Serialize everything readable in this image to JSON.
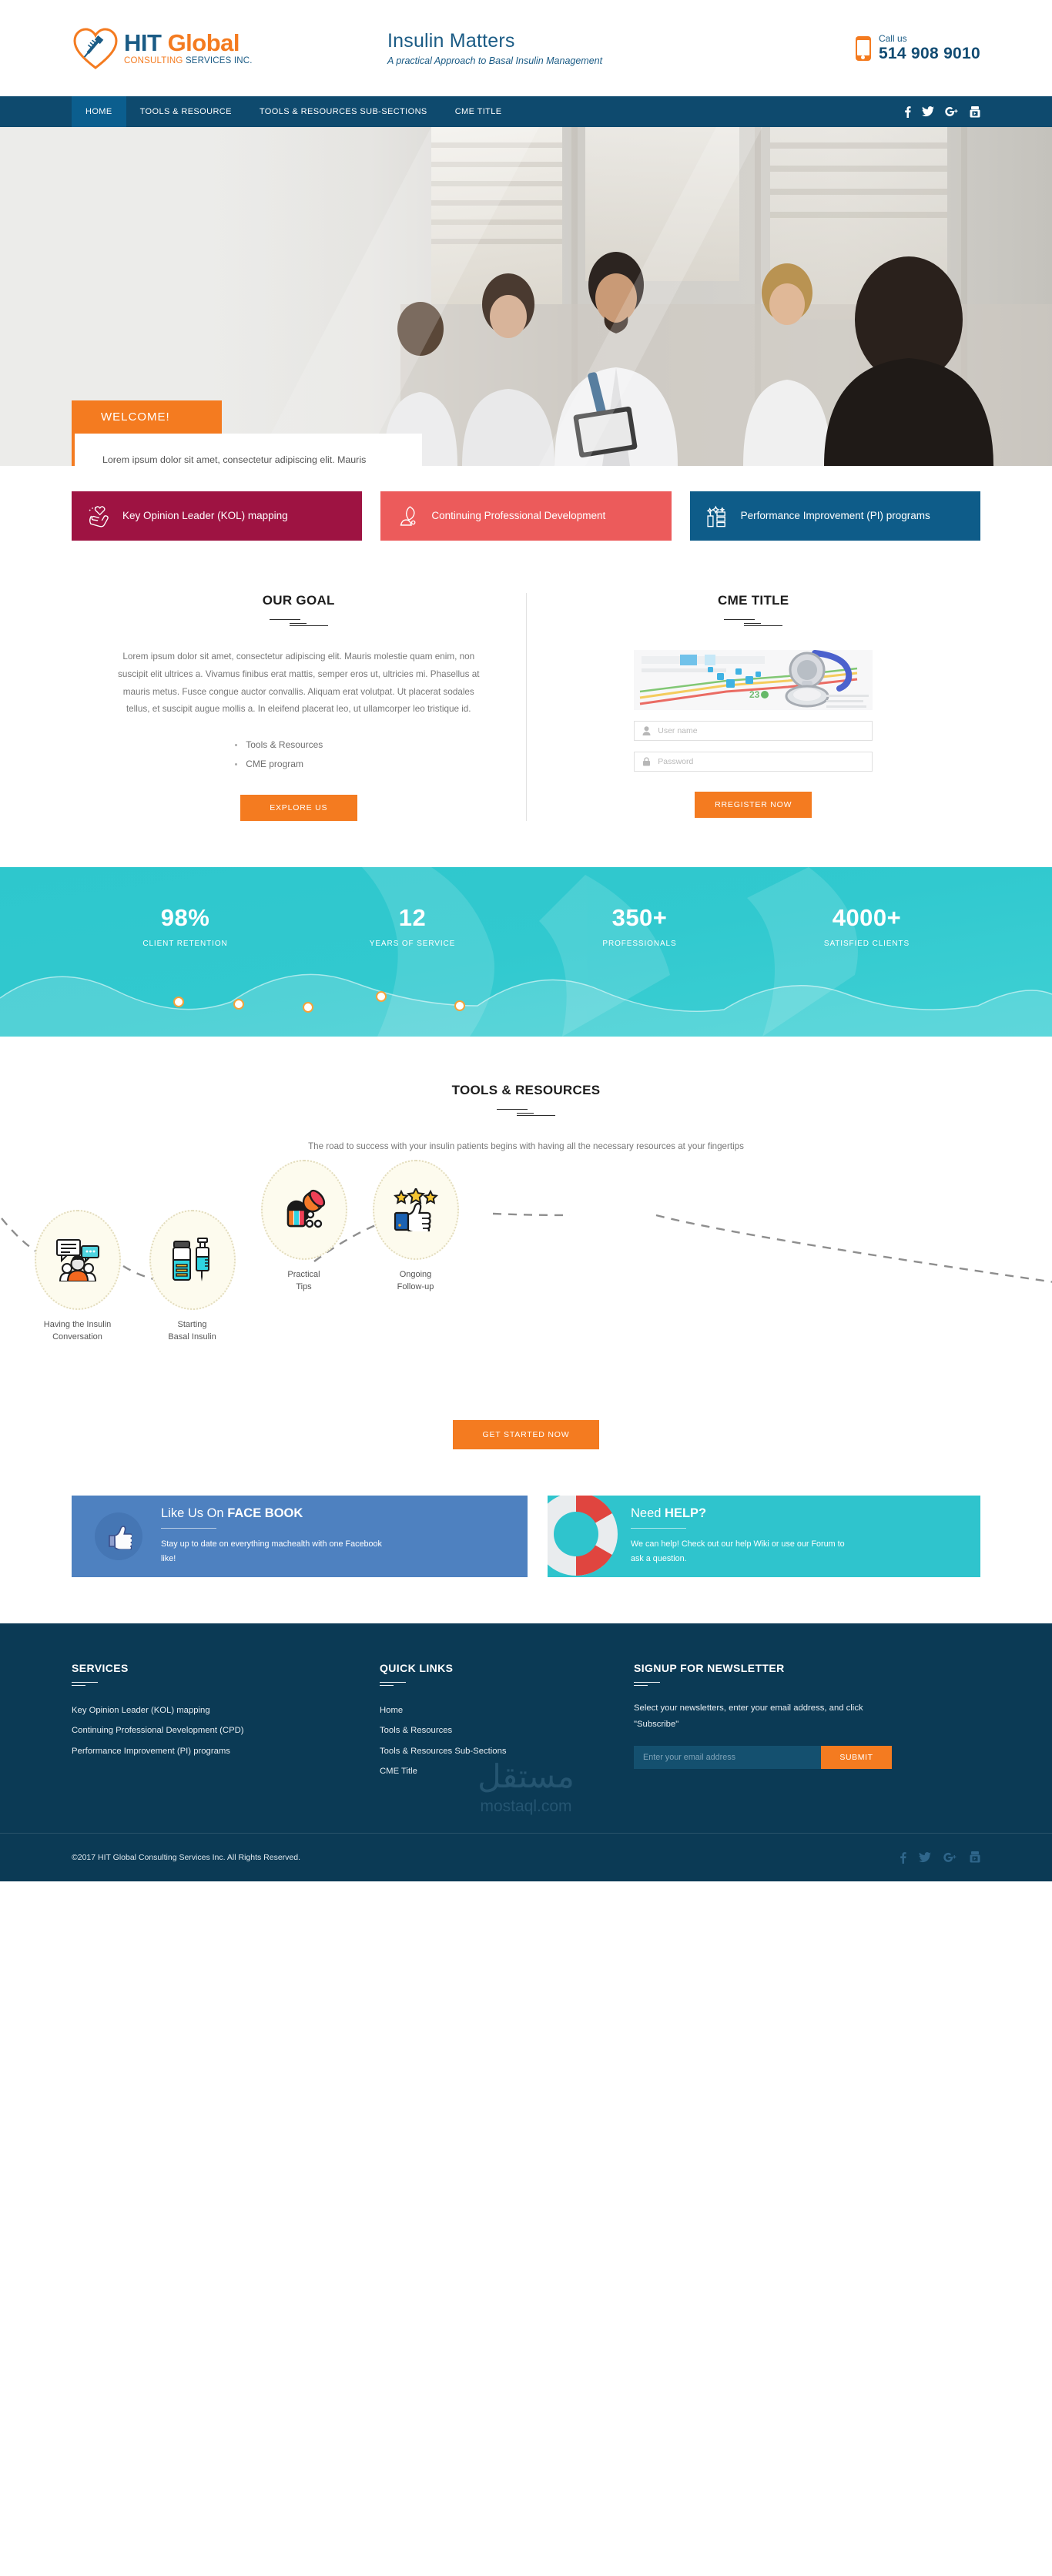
{
  "header": {
    "logo": {
      "part1": "HIT",
      "part2": "Global",
      "sub1": "CONSULTING ",
      "sub2": "SERVICES INC.",
      "icon": "heart-syringe-logo-icon"
    },
    "brand_title": "Insulin Matters",
    "brand_subtitle": "A practical Approach to Basal Insulin Management",
    "call_label": "Call us",
    "phone": "514 908 9010"
  },
  "nav": {
    "items": [
      {
        "label": "HOME",
        "active": true
      },
      {
        "label": "TOOLS & RESOURCE",
        "active": false
      },
      {
        "label": "TOOLS & RESOURCES SUB-SECTIONS",
        "active": false
      },
      {
        "label": "CME TITLE",
        "active": false
      }
    ],
    "social": [
      "facebook-icon",
      "twitter-icon",
      "google-plus-icon",
      "youtube-icon"
    ]
  },
  "hero": {
    "badge": "WELCOME!",
    "text": "Lorem ipsum dolor sit amet, consectetur adipiscing elit. Mauris molestie quam enim, non suscipit elit ultrices a. Vivamus finibus erat mattis, semper eros ut, ultricies mi. Phasellus at mauris metus."
  },
  "service_cards": [
    {
      "title": "Key Opinion Leader (KOL) mapping",
      "color": "#9e1342",
      "icon": "hand-heart-icon"
    },
    {
      "title": "Continuing Professional Development",
      "color": "#ec5b5b",
      "icon": "graduation-pen-icon"
    },
    {
      "title": "Performance Improvement (PI) programs",
      "color": "#0e5c89",
      "icon": "chart-growth-icon"
    }
  ],
  "goal": {
    "title": "OUR GOAL",
    "body": "Lorem ipsum dolor sit amet, consectetur adipiscing elit. Mauris molestie quam enim, non suscipit elit ultrices a. Vivamus finibus erat mattis, semper eros ut, ultricies mi. Phasellus at mauris metus. Fusce congue auctor convallis. Aliquam erat volutpat. Ut placerat sodales tellus, et suscipit augue mollis a. In eleifend placerat leo, ut ullamcorper leo tristique id.",
    "list": [
      "Tools & Resources",
      "CME program"
    ],
    "button": "EXPLORE US"
  },
  "cme": {
    "title": "CME TITLE",
    "image_alt": "stethoscope-on-chart-photo",
    "username_placeholder": "User name",
    "username_value": "",
    "password_placeholder": "Password",
    "password_value": "",
    "button": "RREGISTER NOW",
    "user_icon": "user-icon",
    "lock_icon": "lock-icon"
  },
  "stats": [
    {
      "value": "98%",
      "label": "CLIENT RETENTION"
    },
    {
      "value": "12",
      "label": "YEARS OF SERVICE"
    },
    {
      "value": "350+",
      "label": "PROFESSIONALS"
    },
    {
      "value": "4000+",
      "label": "SATISFIED CLIENTS"
    }
  ],
  "tools": {
    "title": "TOOLS & RESOURCES",
    "subtitle": "The road to success with your insulin patients begins with having all the necessary resources at your fingertips",
    "steps": [
      {
        "line1": "Having the Insulin",
        "line2": "Conversation",
        "icon": "conversation-people-icon"
      },
      {
        "line1": "Starting",
        "line2": "Basal Insulin",
        "icon": "vial-syringe-icon"
      },
      {
        "line1": "Practical",
        "line2": "Tips",
        "icon": "pills-capsules-icon"
      },
      {
        "line1": "Ongoing",
        "line2": "Follow-up",
        "icon": "thumbs-up-stars-icon"
      }
    ],
    "button": "GET STARTED NOW"
  },
  "promos": [
    {
      "title_light": "Like Us On ",
      "title_bold": "FACE BOOK",
      "text": "Stay up to date on everything machealth with one Facebook like!",
      "color": "#4e81c0",
      "icon": "facebook-thumb-icon"
    },
    {
      "title_light": "Need ",
      "title_bold": "HELP?",
      "text": "We can help! Check out our help Wiki or use our Forum to ask a question.",
      "color": "#2fc4cd",
      "icon": "lifebuoy-icon"
    }
  ],
  "footer": {
    "services_title": "SERVICES",
    "services": [
      "Key Opinion Leader (KOL) mapping",
      "Continuing Professional Development (CPD)",
      "Performance Improvement (PI) programs"
    ],
    "quick_links_title": "QUICK LINKS",
    "quick_links": [
      "Home",
      "Tools & Resources",
      "Tools & Resources Sub-Sections",
      "CME Title"
    ],
    "newsletter_title": "SIGNUP FOR NEWSLETTER",
    "newsletter_text": "Select your newsletters, enter your email address, and click \"Subscribe\"",
    "email_placeholder": "Enter your email address",
    "email_value": "",
    "submit": "SUBMIT",
    "copyright": "©2017 HIT Global Consulting Services Inc. All Rights Reserved.",
    "social": [
      "facebook-icon",
      "twitter-icon",
      "google-plus-icon",
      "youtube-icon"
    ],
    "watermark_ar": "مستقل",
    "watermark_en": "mostaql.com"
  }
}
